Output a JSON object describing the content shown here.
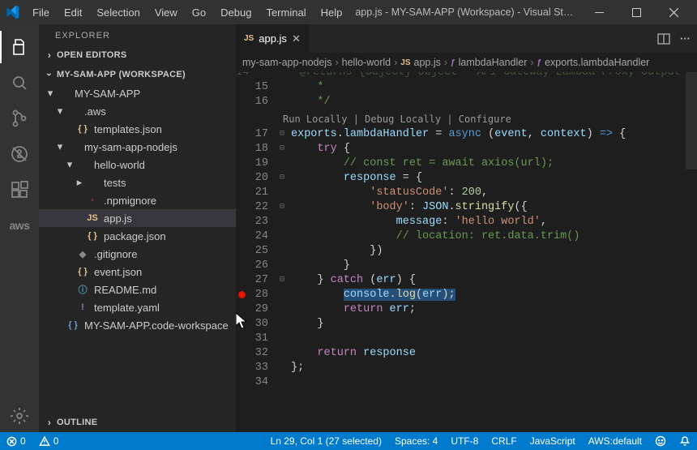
{
  "title": "app.js - MY-SAM-APP (Workspace) - Visual Studio C…",
  "menu": [
    "File",
    "Edit",
    "Selection",
    "View",
    "Go",
    "Debug",
    "Terminal",
    "Help"
  ],
  "activity": {
    "items": [
      "explorer",
      "search",
      "source-control",
      "debug",
      "extensions",
      "aws"
    ],
    "aws_label": "aws"
  },
  "explorer": {
    "title": "EXPLORER",
    "sections": {
      "open_editors": "OPEN EDITORS",
      "workspace": "MY-SAM-APP (WORKSPACE)",
      "outline": "OUTLINE"
    },
    "tree": [
      {
        "label": "MY-SAM-APP",
        "depth": 0,
        "kind": "folder-open",
        "icon": "",
        "color": ""
      },
      {
        "label": ".aws",
        "depth": 1,
        "kind": "folder-open",
        "icon": "",
        "color": ""
      },
      {
        "label": "templates.json",
        "depth": 2,
        "kind": "file",
        "icon": "{ }",
        "color": "ic-yellow"
      },
      {
        "label": "my-sam-app-nodejs",
        "depth": 1,
        "kind": "folder-open",
        "icon": "",
        "color": ""
      },
      {
        "label": "hello-world",
        "depth": 2,
        "kind": "folder-open",
        "icon": "",
        "color": ""
      },
      {
        "label": "tests",
        "depth": 3,
        "kind": "folder",
        "icon": "",
        "color": ""
      },
      {
        "label": ".npmignore",
        "depth": 3,
        "kind": "file",
        "icon": "◦",
        "color": "ic-red"
      },
      {
        "label": "app.js",
        "depth": 3,
        "kind": "file",
        "icon": "JS",
        "color": "ic-yellow",
        "selected": true
      },
      {
        "label": "package.json",
        "depth": 3,
        "kind": "file",
        "icon": "{ }",
        "color": "ic-yellow"
      },
      {
        "label": ".gitignore",
        "depth": 2,
        "kind": "file",
        "icon": "◆",
        "color": "ic-gray"
      },
      {
        "label": "event.json",
        "depth": 2,
        "kind": "file",
        "icon": "{ }",
        "color": "ic-yellow"
      },
      {
        "label": "README.md",
        "depth": 2,
        "kind": "file",
        "icon": "ⓘ",
        "color": "ic-blue"
      },
      {
        "label": "template.yaml",
        "depth": 2,
        "kind": "file",
        "icon": "!",
        "color": "ic-purple"
      },
      {
        "label": "MY-SAM-APP.code-workspace",
        "depth": 1,
        "kind": "file",
        "icon": "{ }",
        "color": "ic-lightblue"
      }
    ]
  },
  "tabs": [
    {
      "icon": "JS",
      "label": "app.js"
    }
  ],
  "breadcrumbs": [
    {
      "icon": "",
      "label": "my-sam-app-nodejs"
    },
    {
      "icon": "",
      "label": "hello-world"
    },
    {
      "icon": "JS",
      "label": "app.js",
      "color": "ic-yellow"
    },
    {
      "icon": "ƒ",
      "label": "lambdaHandler",
      "color": "ic-purple"
    },
    {
      "icon": "ƒ",
      "label": "exports.lambdaHandler",
      "color": "ic-purple"
    }
  ],
  "codelens": {
    "run": "Run Locally",
    "debug": "Debug Locally",
    "configure": "Configure"
  },
  "code_first_line": 14,
  "code": [
    {
      "n": 14,
      "fold": "",
      "html": "    <span class='tok-cm'>* @returns {object} object   API Gateway Lambda Proxy Output F</span>"
    },
    {
      "n": 15,
      "fold": "",
      "html": "    <span class='tok-cm'>*</span>"
    },
    {
      "n": 16,
      "fold": "",
      "html": "    <span class='tok-cm'>*/</span>"
    },
    {
      "n": 17,
      "fold": "⊟",
      "html": "<span class='tok-id'>exports</span>.<span class='tok-id'>lambdaHandler</span> <span class='tok-op'>=</span> <span class='tok-k'>async</span> (<span class='tok-id'>event</span>, <span class='tok-id'>context</span>) <span class='tok-k'>=&gt;</span> {"
    },
    {
      "n": 18,
      "fold": "⊟",
      "html": "    <span class='tok-kf'>try</span> {"
    },
    {
      "n": 19,
      "fold": "",
      "html": "        <span class='tok-cm'>// const ret = await axios(url);</span>"
    },
    {
      "n": 20,
      "fold": "⊟",
      "html": "        <span class='tok-id'>response</span> <span class='tok-op'>=</span> {"
    },
    {
      "n": 21,
      "fold": "",
      "html": "            <span class='tok-str'>'statusCode'</span>: <span class='tok-num'>200</span>,"
    },
    {
      "n": 22,
      "fold": "⊟",
      "html": "            <span class='tok-str'>'body'</span>: <span class='tok-id'>JSON</span>.<span class='tok-fn'>stringify</span>({"
    },
    {
      "n": 23,
      "fold": "",
      "html": "                <span class='tok-id'>message</span>: <span class='tok-str'>'hello world'</span>,"
    },
    {
      "n": 24,
      "fold": "",
      "html": "                <span class='tok-cm'>// location: ret.data.trim()</span>"
    },
    {
      "n": 25,
      "fold": "",
      "html": "            })"
    },
    {
      "n": 26,
      "fold": "",
      "html": "        }"
    },
    {
      "n": 27,
      "fold": "⊟",
      "html": "    } <span class='tok-kf'>catch</span> (<span class='tok-id'>err</span>) {"
    },
    {
      "n": 28,
      "fold": "",
      "bp": true,
      "html": "        <span class='hl-line'><span class='tok-id'>console</span>.<span class='tok-fn'>log</span>(<span class='tok-id'>err</span>);</span>"
    },
    {
      "n": 29,
      "fold": "",
      "html": "        <span class='tok-kf'>return</span> <span class='tok-id'>err</span>;"
    },
    {
      "n": 30,
      "fold": "",
      "html": "    }"
    },
    {
      "n": 31,
      "fold": "",
      "html": ""
    },
    {
      "n": 32,
      "fold": "",
      "html": "    <span class='tok-kf'>return</span> <span class='tok-id'>response</span>"
    },
    {
      "n": 33,
      "fold": "",
      "html": "};"
    },
    {
      "n": 34,
      "fold": "",
      "html": ""
    }
  ],
  "status": {
    "errors": "0",
    "warnings": "0",
    "cursor": "Ln 29, Col 1 (27 selected)",
    "spaces": "Spaces: 4",
    "encoding": "UTF-8",
    "eol": "CRLF",
    "lang": "JavaScript",
    "aws": "AWS:default"
  }
}
